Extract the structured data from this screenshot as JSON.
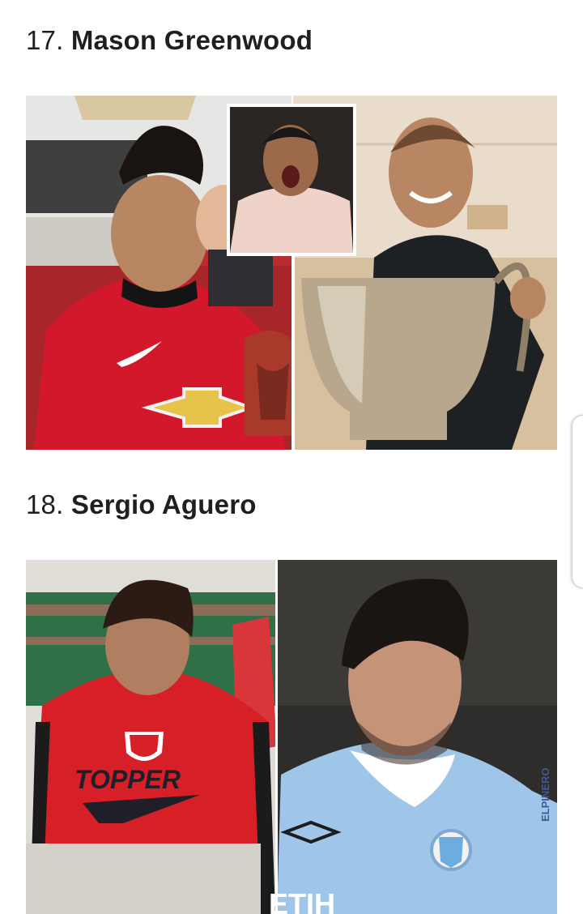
{
  "items": [
    {
      "number": "17.",
      "name": "Mason Greenwood",
      "image_label": "Mason Greenwood childhood and current photo collage"
    },
    {
      "number": "18.",
      "name": "Sergio Aguero",
      "image_label": "Sergio Aguero childhood and current photo collage",
      "watermark": "ELPINERO"
    }
  ],
  "colors": {
    "heading_text": "#1f1f1f",
    "united_red": "#d3182b",
    "city_blue": "#9fc6e8",
    "independiente_red": "#d61f26"
  }
}
